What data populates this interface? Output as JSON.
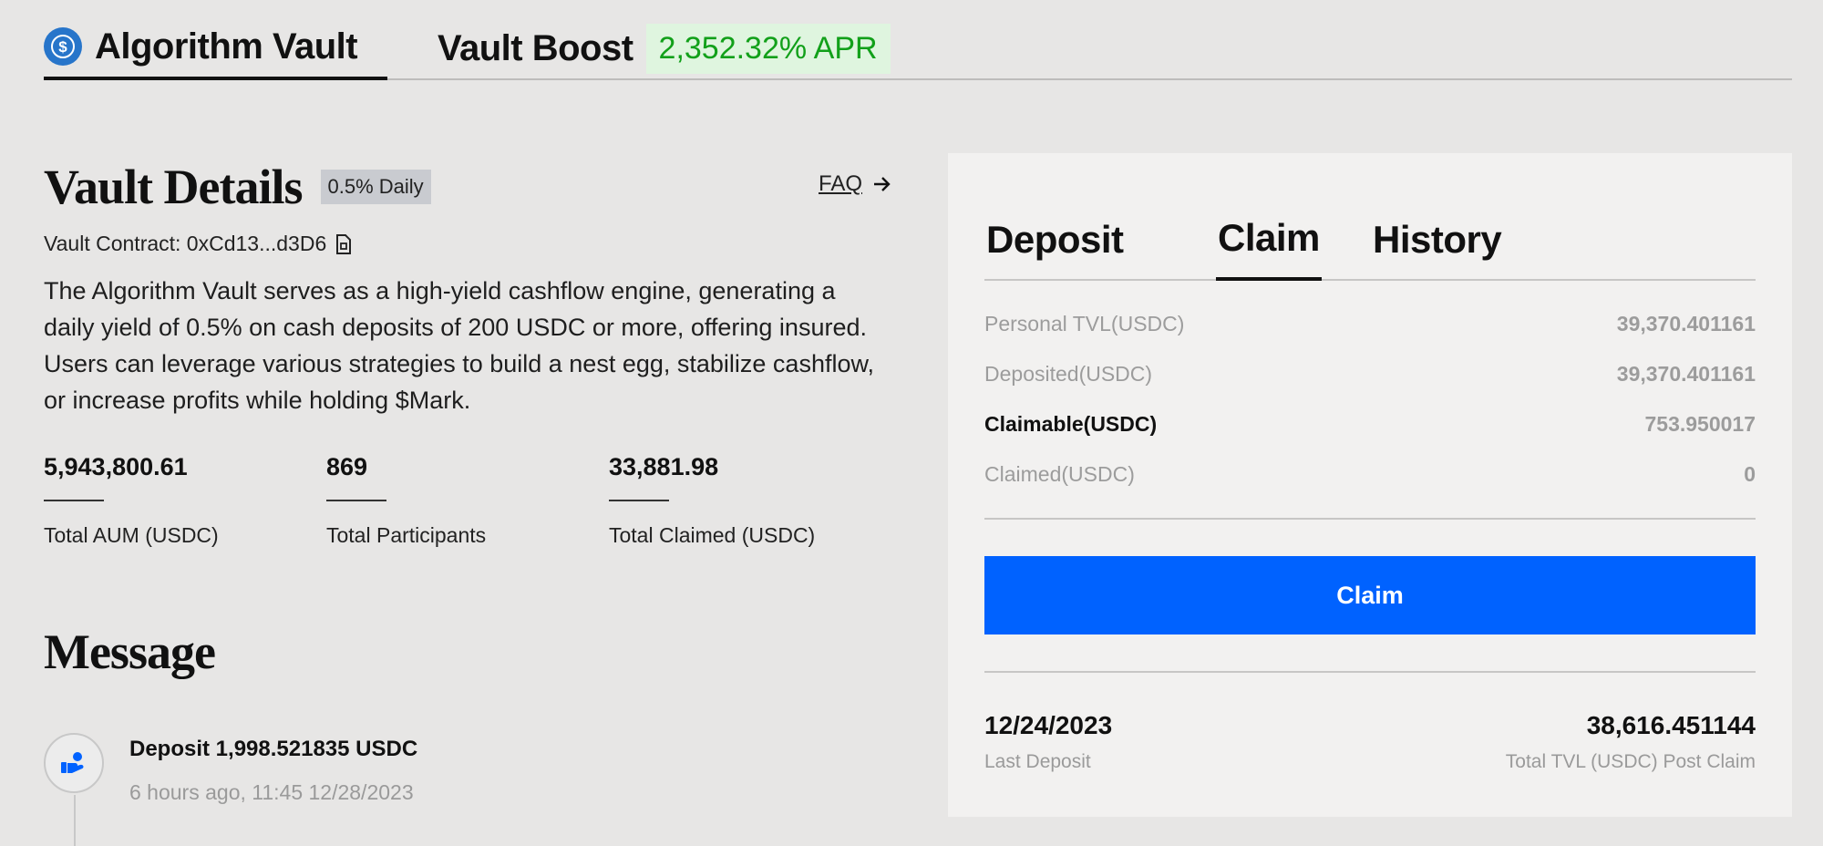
{
  "top_tabs": {
    "vault_label": "Algorithm Vault",
    "boost_label": "Vault Boost",
    "apr": "2,352.32% APR"
  },
  "details": {
    "title": "Vault Details",
    "daily_badge": "0.5% Daily",
    "faq_label": "FAQ",
    "contract_label": "Vault Contract: 0xCd13...d3D6",
    "description": "The Algorithm Vault serves as a high-yield cashflow engine, generating a daily yield of 0.5% on cash deposits of 200 USDC or more, offering insured. Users can leverage various strategies to build a nest egg, stabilize cashflow, or increase profits while holding $Mark.",
    "stats": [
      {
        "value": "5,943,800.61",
        "label": "Total AUM (USDC)"
      },
      {
        "value": "869",
        "label": "Total Participants"
      },
      {
        "value": "33,881.98",
        "label": "Total Claimed (USDC)"
      }
    ]
  },
  "message": {
    "title": "Message",
    "items": [
      {
        "headline": "Deposit 1,998.521835 USDC",
        "time": "6 hours ago, 11:45 12/28/2023"
      }
    ]
  },
  "panel": {
    "tabs": [
      "Deposit",
      "Claim",
      "History"
    ],
    "active_tab": "Claim",
    "rows": [
      {
        "key": "Personal TVL(USDC)",
        "value": "39,370.401161"
      },
      {
        "key": "Deposited(USDC)",
        "value": "39,370.401161"
      },
      {
        "key": "Claimable(USDC)",
        "value": "753.950017"
      },
      {
        "key": "Claimed(USDC)",
        "value": "0"
      }
    ],
    "claim_button": "Claim",
    "last_deposit": {
      "value": "12/24/2023",
      "label": "Last Deposit"
    },
    "post_claim": {
      "value": "38,616.451144",
      "label": "Total TVL (USDC) Post Claim"
    }
  },
  "colors": {
    "accent": "#0062ff",
    "apr_text": "#12a01a",
    "apr_bg": "#dff5df",
    "usdc": "#2775ca"
  }
}
